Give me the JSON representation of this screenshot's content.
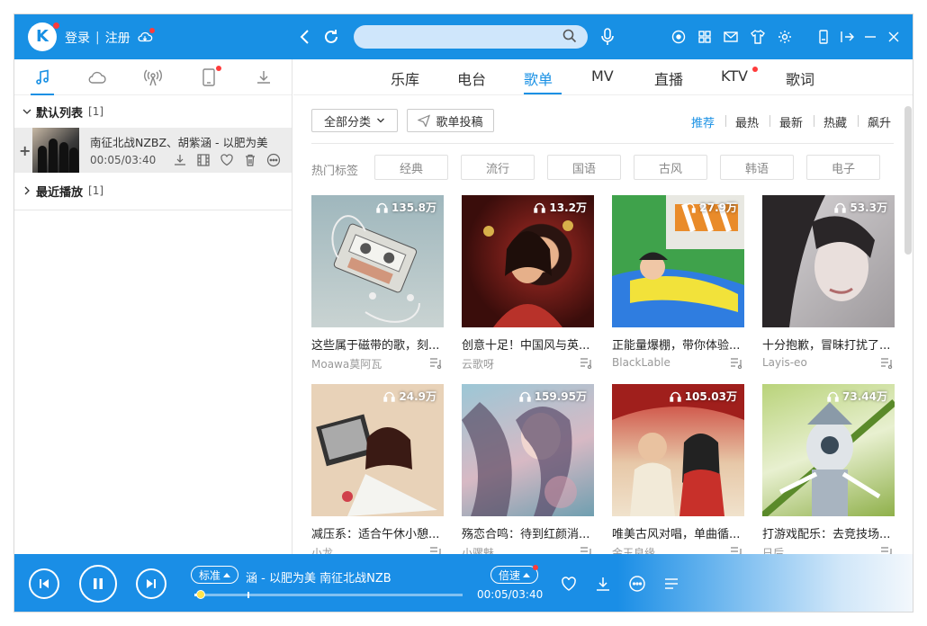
{
  "app": {
    "logo_letter": "K",
    "login": "登录",
    "register": "注册",
    "accent": "#1890e4"
  },
  "sidebar": {
    "tabs": [
      {
        "name": "music-note-icon",
        "active": true
      },
      {
        "name": "cloud-icon"
      },
      {
        "name": "radio-icon"
      },
      {
        "name": "phone-icon",
        "badge": true
      },
      {
        "name": "download-icon"
      }
    ],
    "default_list": {
      "label": "默认列表",
      "count": "[1]"
    },
    "song": {
      "title": "南征北战NZBZ、胡紫涵 - 以肥为美",
      "time": "00:05/03:40"
    },
    "recent": {
      "label": "最近播放",
      "count": "[1]"
    }
  },
  "main": {
    "tabs": [
      "乐库",
      "电台",
      "歌单",
      "MV",
      "直播",
      "KTV",
      "歌词"
    ],
    "active_tab": "歌单",
    "category_button": "全部分类",
    "submit_button": "歌单投稿",
    "sorts": [
      "推荐",
      "最热",
      "最新",
      "热藏",
      "飙升"
    ],
    "active_sort": "推荐",
    "tags_label": "热门标签",
    "tags": [
      "经典",
      "流行",
      "国语",
      "古风",
      "韩语",
      "电子"
    ],
    "playlists": [
      {
        "plays": "135.8万",
        "title": "这些属于磁带的歌，刻...",
        "author": "Moawa莫阿瓦"
      },
      {
        "plays": "13.2万",
        "title": "创意十足！中国风与英...",
        "author": "云歌呀"
      },
      {
        "plays": "27.9万",
        "title": "正能量爆棚，带你体验...",
        "author": "BlackLable"
      },
      {
        "plays": "53.3万",
        "title": "十分抱歉，冒昧打扰了...",
        "author": "Layis-eo"
      },
      {
        "plays": "24.9万",
        "title": "减压系：适合午休小憩...",
        "author": "小龙"
      },
      {
        "plays": "159.95万",
        "title": "殇恋合鸣：待到红颜消...",
        "author": "小骡魅"
      },
      {
        "plays": "105.03万",
        "title": "唯美古风对唱，单曲循...",
        "author": "金玉良缘"
      },
      {
        "plays": "73.44万",
        "title": "打游戏配乐：去竞技场...",
        "author": "日后"
      }
    ]
  },
  "player": {
    "quality": "标准",
    "now_playing": "涵 - 以肥为美    南征北战NZB",
    "speed": "倍速",
    "time": "00:05/03:40",
    "progress_fraction": 0.023
  }
}
